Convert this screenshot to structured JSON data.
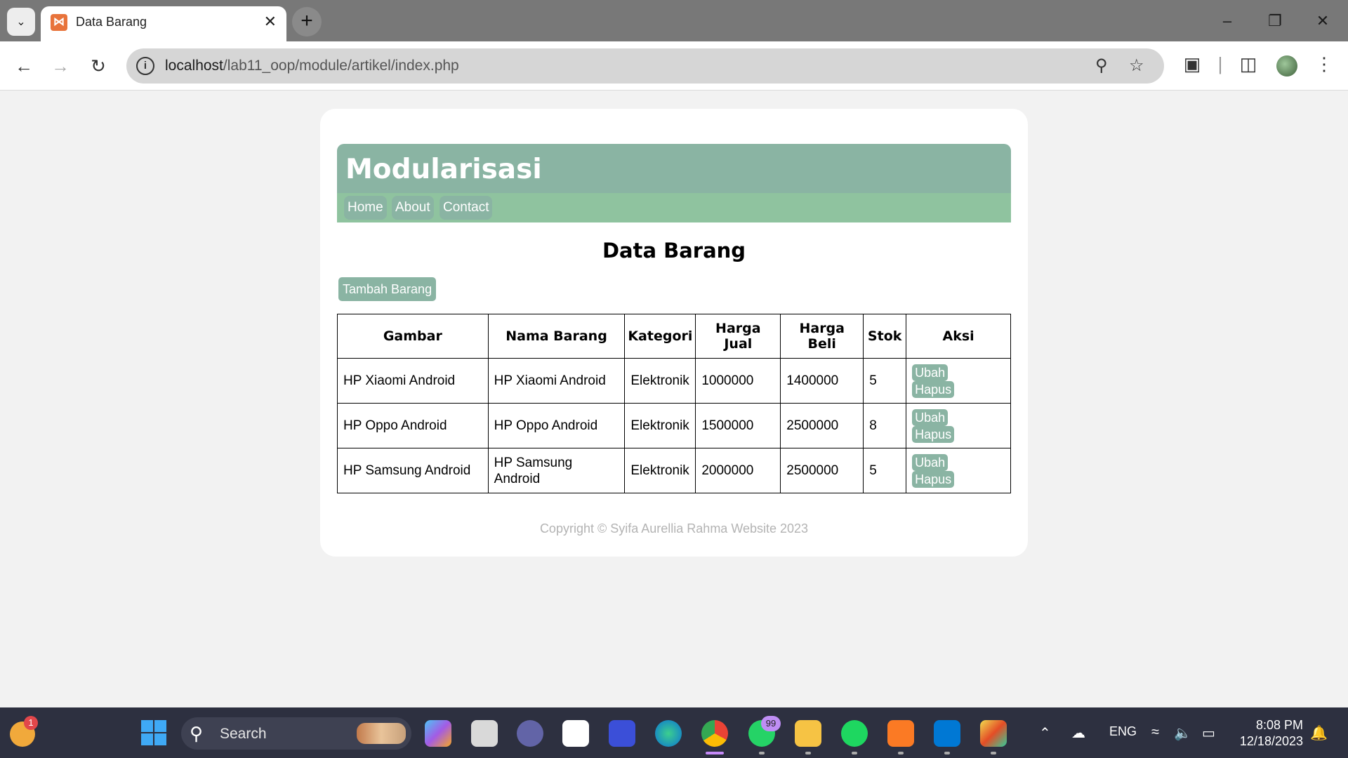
{
  "browser": {
    "tab_title": "Data Barang",
    "url_host": "localhost",
    "url_path": "/lab11_oop/module/artikel/index.php"
  },
  "page": {
    "site_title": "Modularisasi",
    "nav": [
      {
        "label": "Home"
      },
      {
        "label": "About"
      },
      {
        "label": "Contact"
      }
    ],
    "heading": "Data Barang",
    "add_button": "Tambah Barang",
    "table": {
      "columns": [
        "Gambar",
        "Nama Barang",
        "Kategori",
        "Harga Jual",
        "Harga Beli",
        "Stok",
        "Aksi"
      ],
      "col_harga_jual_1": "Harga",
      "col_harga_jual_2": "Jual",
      "col_harga_beli_1": "Harga",
      "col_harga_beli_2": "Beli",
      "rows": [
        {
          "gambar": "HP Xiaomi Android",
          "nama": "HP Xiaomi Android",
          "kategori": "Elektronik",
          "harga_jual": "1000000",
          "harga_beli": "1400000",
          "stok": "5"
        },
        {
          "gambar": "HP Oppo Android",
          "nama": "HP Oppo Android",
          "kategori": "Elektronik",
          "harga_jual": "1500000",
          "harga_beli": "2500000",
          "stok": "8"
        },
        {
          "gambar": "HP Samsung Android",
          "nama": "HP Samsung Android",
          "kategori": "Elektronik",
          "harga_jual": "2000000",
          "harga_beli": "2500000",
          "stok": "5"
        }
      ],
      "edit_label": "Ubah",
      "delete_label": "Hapus"
    },
    "footer": "Copyright © Syifa Aurellia Rahma Website 2023"
  },
  "taskbar": {
    "search_placeholder": "Search",
    "weather_badge": "1",
    "whatsapp_badge": "99",
    "language": "ENG",
    "time": "8:08 PM",
    "date": "12/18/2023"
  },
  "colors": {
    "accent_green": "#8ab4a3",
    "nav_green": "#8fc39f",
    "taskbar": "#2d3040"
  }
}
